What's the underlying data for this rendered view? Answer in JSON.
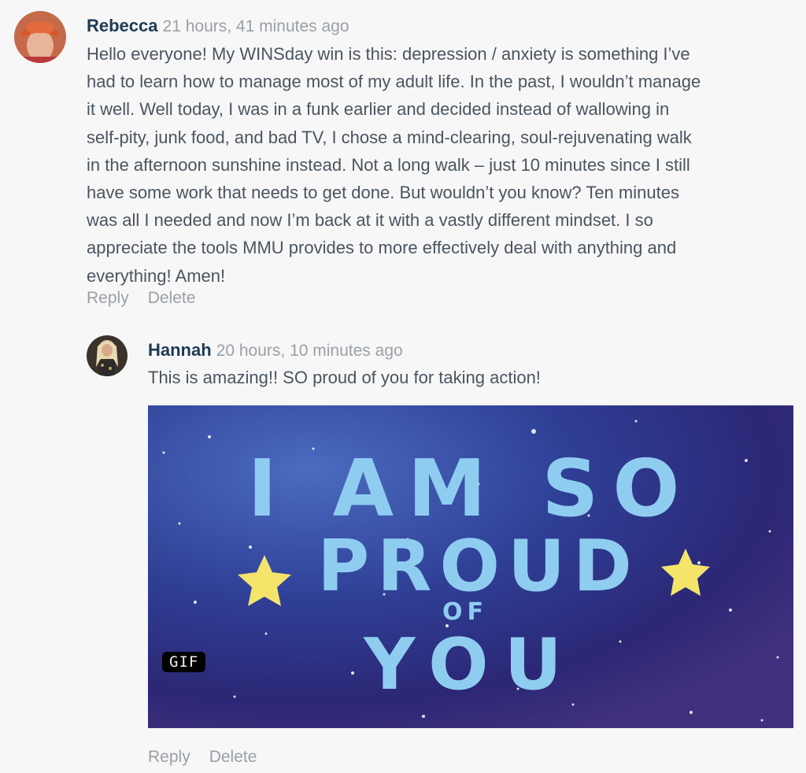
{
  "comments": [
    {
      "author": "Rebecca",
      "time": "21 hours, 41 minutes ago",
      "lines": [
        "Hello everyone!  My WINSday win is this:  depression / anxiety is something I’ve",
        "had to learn how to manage most of my adult life.  In the past, I wouldn’t manage",
        "it well.  Well today, I was in a funk earlier and decided instead of wallowing in",
        "self-pity, junk food, and bad TV, I chose a mind-clearing, soul-rejuvenating walk",
        "in the afternoon sunshine instead.  Not a long walk – just 10 minutes since I still",
        "have some work that needs to get done. But wouldn’t you know?  Ten minutes",
        "was all I needed and now I’m back at it with a vastly different mindset.  I so",
        "appreciate the tools MMU provides to more effectively deal with anything and",
        "everything!   Amen!"
      ],
      "reply_label": "Reply",
      "delete_label": "Delete"
    },
    {
      "author": "Hannah",
      "time": "20 hours, 10 minutes ago",
      "text": "This is amazing!! SO proud of you for taking action!",
      "gif": {
        "badge": "GIF",
        "text_line1": "I AM SO",
        "text_line2": "PROUD",
        "text_line3": "OF",
        "text_line4": "YOU"
      },
      "reply_label": "Reply",
      "delete_label": "Delete"
    }
  ]
}
